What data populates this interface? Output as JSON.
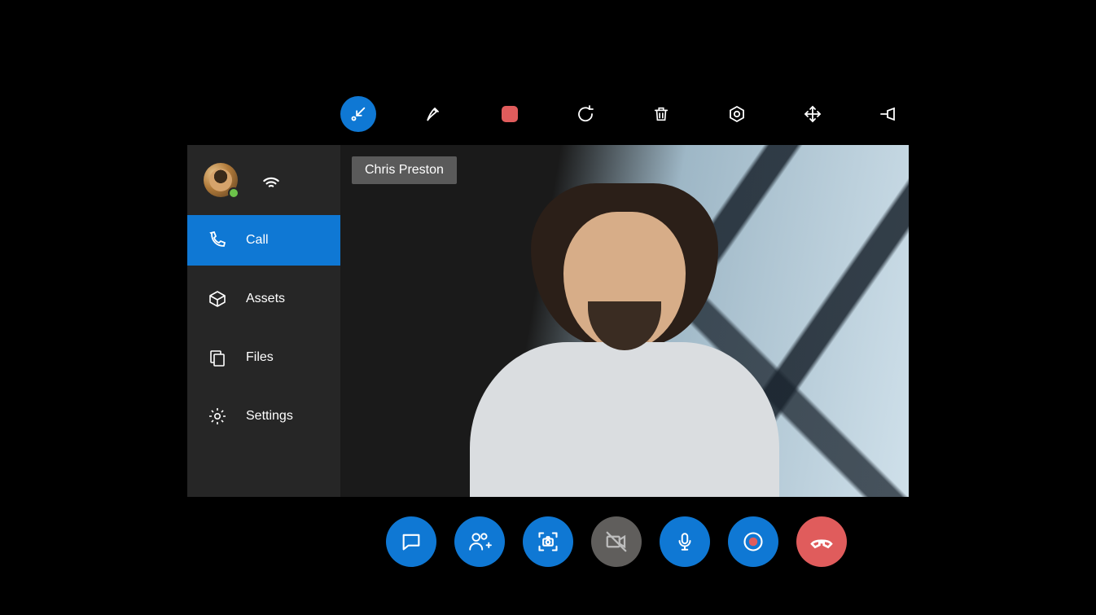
{
  "colors": {
    "accent": "#0f78d4",
    "danger": "#e05c5c",
    "muted": "#605e5c",
    "presence_available": "#6cc24a"
  },
  "top_toolbar": {
    "items": [
      {
        "name": "annotate-arrow",
        "active": true
      },
      {
        "name": "ink-pen"
      },
      {
        "name": "stop-record"
      },
      {
        "name": "undo"
      },
      {
        "name": "delete"
      },
      {
        "name": "settings-alt"
      },
      {
        "name": "move-fullscreen"
      },
      {
        "name": "pin"
      }
    ]
  },
  "sidebar": {
    "user": {
      "presence": "available"
    },
    "wifi_icon": "wifi-icon",
    "items": [
      {
        "icon": "phone-icon",
        "label": "Call",
        "active": true
      },
      {
        "icon": "box-icon",
        "label": "Assets",
        "active": false
      },
      {
        "icon": "files-icon",
        "label": "Files",
        "active": false
      },
      {
        "icon": "gear-icon",
        "label": "Settings",
        "active": false
      }
    ]
  },
  "video": {
    "participant_name": "Chris Preston"
  },
  "call_controls": {
    "buttons": [
      {
        "name": "chat",
        "color": "blue"
      },
      {
        "name": "add-people",
        "color": "blue"
      },
      {
        "name": "capture",
        "color": "blue"
      },
      {
        "name": "video-off",
        "color": "gray"
      },
      {
        "name": "mic",
        "color": "blue"
      },
      {
        "name": "record",
        "color": "blue"
      },
      {
        "name": "hang-up",
        "color": "red"
      }
    ]
  }
}
